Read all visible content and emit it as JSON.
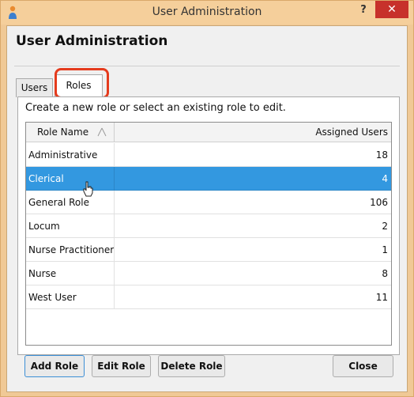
{
  "window": {
    "title": "User Administration",
    "help_label": "?",
    "close_label": "✕"
  },
  "heading": "User Administration",
  "tabs": [
    {
      "label": "Users",
      "active": false
    },
    {
      "label": "Roles",
      "active": true
    }
  ],
  "instruction": "Create a new role or select an existing role to edit.",
  "table": {
    "columns": [
      "Role Name",
      "Assigned Users"
    ],
    "rows": [
      {
        "name": "Administrative",
        "users": "18",
        "selected": false
      },
      {
        "name": "Clerical",
        "users": "4",
        "selected": true
      },
      {
        "name": "General Role",
        "users": "106",
        "selected": false
      },
      {
        "name": "Locum",
        "users": "2",
        "selected": false
      },
      {
        "name": "Nurse Practitioner",
        "users": "1",
        "selected": false
      },
      {
        "name": "Nurse",
        "users": "8",
        "selected": false
      },
      {
        "name": "West User",
        "users": "11",
        "selected": false
      }
    ]
  },
  "buttons": {
    "add": "Add Role",
    "edit": "Edit Role",
    "delete": "Delete Role",
    "close": "Close"
  },
  "colors": {
    "selection": "#3398e0",
    "highlight": "#e53b1d",
    "titlebar": "#f5cf9b",
    "close_button": "#c7312b"
  }
}
